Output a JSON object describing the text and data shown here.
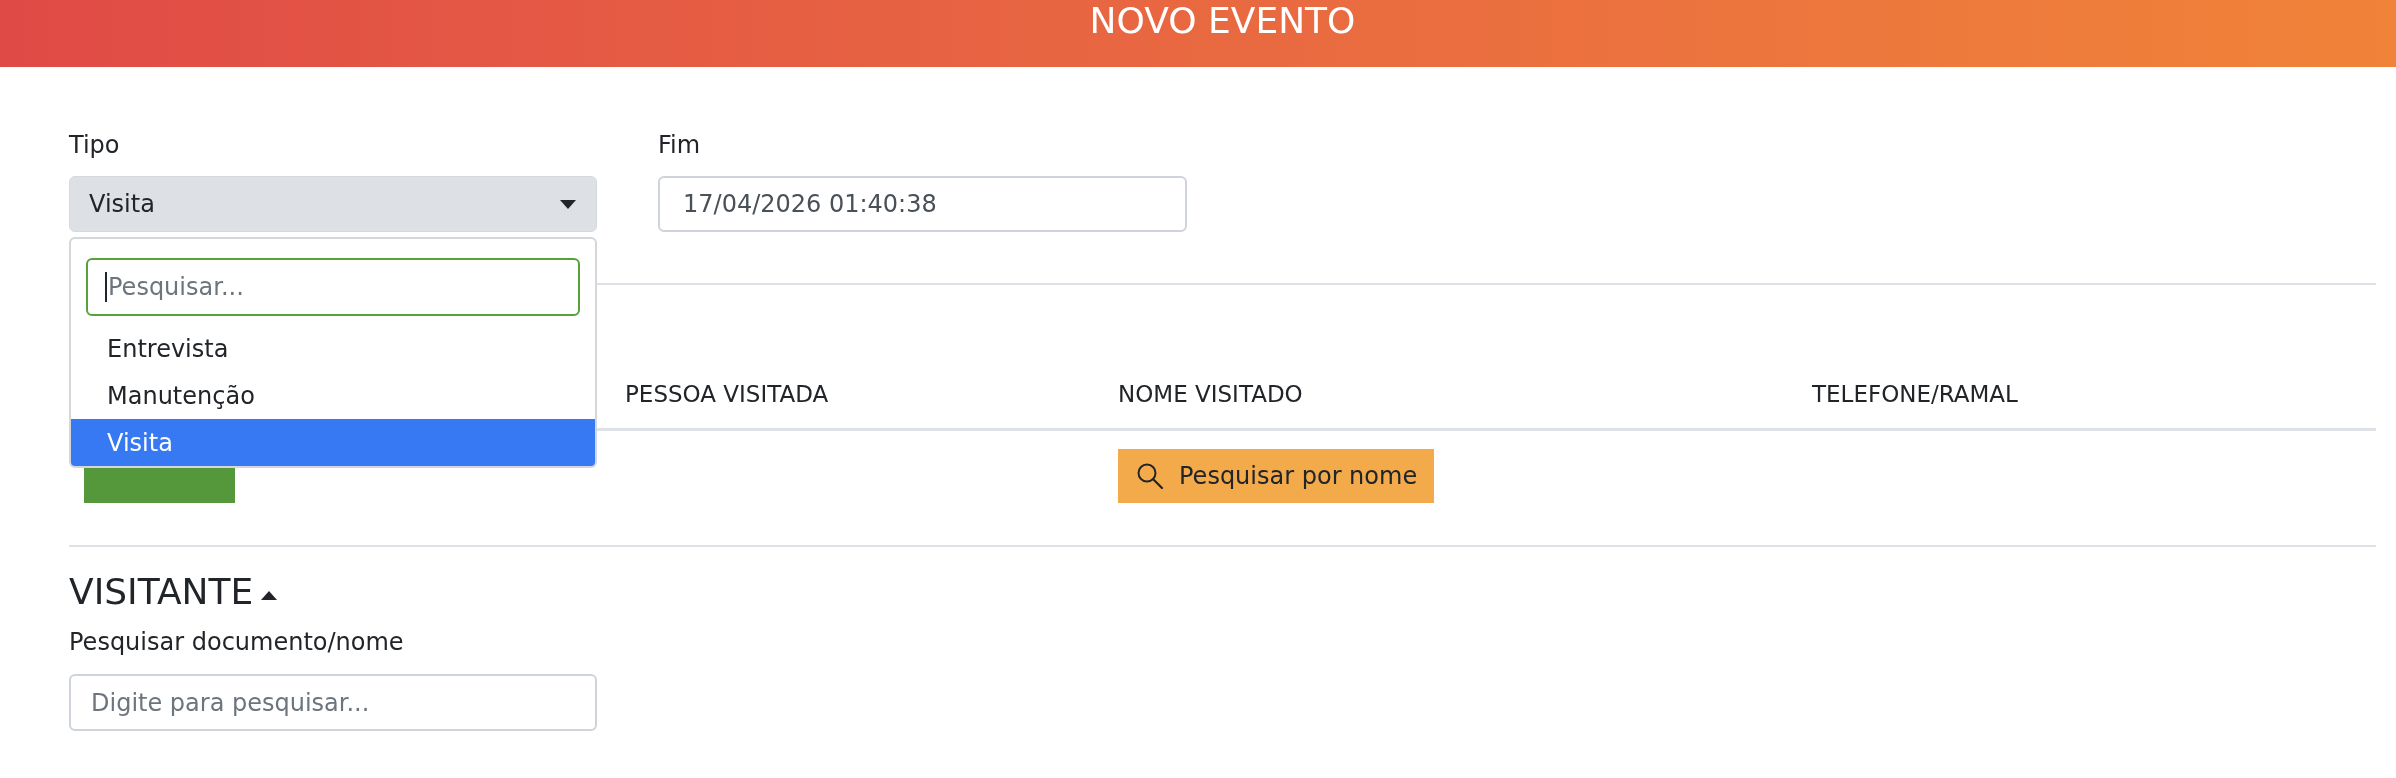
{
  "header": {
    "title": "NOVO EVENTO"
  },
  "tipo": {
    "label": "Tipo",
    "value": "Visita",
    "expanded": true,
    "search": {
      "placeholder": "Pesquisar...",
      "focused": true
    },
    "options": [
      {
        "label": "Entrevista",
        "selected": false
      },
      {
        "label": "Manutenção",
        "selected": false
      },
      {
        "label": "Visita",
        "selected": true
      }
    ]
  },
  "fim": {
    "label": "Fim",
    "value": "17/04/2026 01:40:38"
  },
  "table": {
    "columns": [
      {
        "label": "PESSOA VISITADA"
      },
      {
        "label": "NOME VISITADO"
      },
      {
        "label": "TELEFONE/RAMAL"
      }
    ],
    "search_button": "Pesquisar por nome"
  },
  "visitante": {
    "title": "VISITANTE",
    "expanded": true,
    "search_label": "Pesquisar documento/nome",
    "search_placeholder": "Digite para pesquisar..."
  }
}
